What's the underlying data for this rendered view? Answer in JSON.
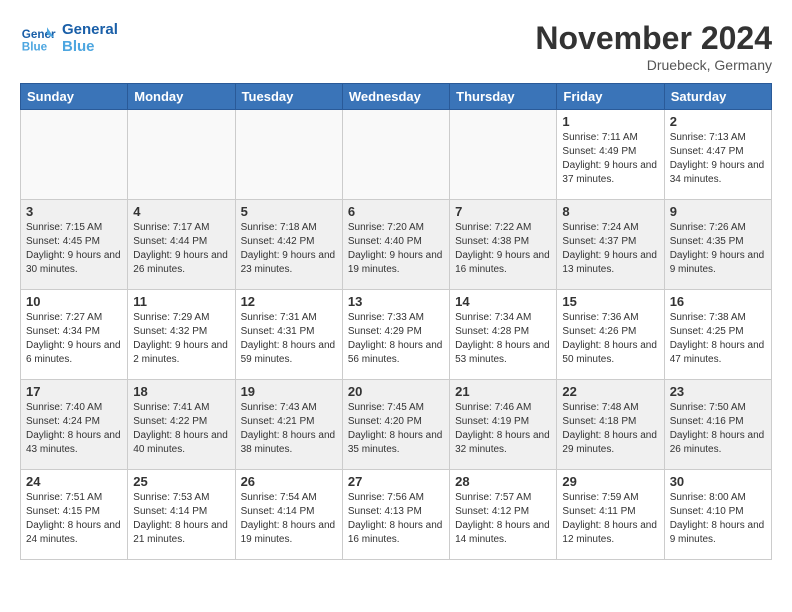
{
  "header": {
    "logo_line1": "General",
    "logo_line2": "Blue",
    "month_title": "November 2024",
    "location": "Druebeck, Germany"
  },
  "weekdays": [
    "Sunday",
    "Monday",
    "Tuesday",
    "Wednesday",
    "Thursday",
    "Friday",
    "Saturday"
  ],
  "weeks": [
    [
      {
        "day": "",
        "info": ""
      },
      {
        "day": "",
        "info": ""
      },
      {
        "day": "",
        "info": ""
      },
      {
        "day": "",
        "info": ""
      },
      {
        "day": "",
        "info": ""
      },
      {
        "day": "1",
        "info": "Sunrise: 7:11 AM\nSunset: 4:49 PM\nDaylight: 9 hours and 37 minutes."
      },
      {
        "day": "2",
        "info": "Sunrise: 7:13 AM\nSunset: 4:47 PM\nDaylight: 9 hours and 34 minutes."
      }
    ],
    [
      {
        "day": "3",
        "info": "Sunrise: 7:15 AM\nSunset: 4:45 PM\nDaylight: 9 hours and 30 minutes."
      },
      {
        "day": "4",
        "info": "Sunrise: 7:17 AM\nSunset: 4:44 PM\nDaylight: 9 hours and 26 minutes."
      },
      {
        "day": "5",
        "info": "Sunrise: 7:18 AM\nSunset: 4:42 PM\nDaylight: 9 hours and 23 minutes."
      },
      {
        "day": "6",
        "info": "Sunrise: 7:20 AM\nSunset: 4:40 PM\nDaylight: 9 hours and 19 minutes."
      },
      {
        "day": "7",
        "info": "Sunrise: 7:22 AM\nSunset: 4:38 PM\nDaylight: 9 hours and 16 minutes."
      },
      {
        "day": "8",
        "info": "Sunrise: 7:24 AM\nSunset: 4:37 PM\nDaylight: 9 hours and 13 minutes."
      },
      {
        "day": "9",
        "info": "Sunrise: 7:26 AM\nSunset: 4:35 PM\nDaylight: 9 hours and 9 minutes."
      }
    ],
    [
      {
        "day": "10",
        "info": "Sunrise: 7:27 AM\nSunset: 4:34 PM\nDaylight: 9 hours and 6 minutes."
      },
      {
        "day": "11",
        "info": "Sunrise: 7:29 AM\nSunset: 4:32 PM\nDaylight: 9 hours and 2 minutes."
      },
      {
        "day": "12",
        "info": "Sunrise: 7:31 AM\nSunset: 4:31 PM\nDaylight: 8 hours and 59 minutes."
      },
      {
        "day": "13",
        "info": "Sunrise: 7:33 AM\nSunset: 4:29 PM\nDaylight: 8 hours and 56 minutes."
      },
      {
        "day": "14",
        "info": "Sunrise: 7:34 AM\nSunset: 4:28 PM\nDaylight: 8 hours and 53 minutes."
      },
      {
        "day": "15",
        "info": "Sunrise: 7:36 AM\nSunset: 4:26 PM\nDaylight: 8 hours and 50 minutes."
      },
      {
        "day": "16",
        "info": "Sunrise: 7:38 AM\nSunset: 4:25 PM\nDaylight: 8 hours and 47 minutes."
      }
    ],
    [
      {
        "day": "17",
        "info": "Sunrise: 7:40 AM\nSunset: 4:24 PM\nDaylight: 8 hours and 43 minutes."
      },
      {
        "day": "18",
        "info": "Sunrise: 7:41 AM\nSunset: 4:22 PM\nDaylight: 8 hours and 40 minutes."
      },
      {
        "day": "19",
        "info": "Sunrise: 7:43 AM\nSunset: 4:21 PM\nDaylight: 8 hours and 38 minutes."
      },
      {
        "day": "20",
        "info": "Sunrise: 7:45 AM\nSunset: 4:20 PM\nDaylight: 8 hours and 35 minutes."
      },
      {
        "day": "21",
        "info": "Sunrise: 7:46 AM\nSunset: 4:19 PM\nDaylight: 8 hours and 32 minutes."
      },
      {
        "day": "22",
        "info": "Sunrise: 7:48 AM\nSunset: 4:18 PM\nDaylight: 8 hours and 29 minutes."
      },
      {
        "day": "23",
        "info": "Sunrise: 7:50 AM\nSunset: 4:16 PM\nDaylight: 8 hours and 26 minutes."
      }
    ],
    [
      {
        "day": "24",
        "info": "Sunrise: 7:51 AM\nSunset: 4:15 PM\nDaylight: 8 hours and 24 minutes."
      },
      {
        "day": "25",
        "info": "Sunrise: 7:53 AM\nSunset: 4:14 PM\nDaylight: 8 hours and 21 minutes."
      },
      {
        "day": "26",
        "info": "Sunrise: 7:54 AM\nSunset: 4:14 PM\nDaylight: 8 hours and 19 minutes."
      },
      {
        "day": "27",
        "info": "Sunrise: 7:56 AM\nSunset: 4:13 PM\nDaylight: 8 hours and 16 minutes."
      },
      {
        "day": "28",
        "info": "Sunrise: 7:57 AM\nSunset: 4:12 PM\nDaylight: 8 hours and 14 minutes."
      },
      {
        "day": "29",
        "info": "Sunrise: 7:59 AM\nSunset: 4:11 PM\nDaylight: 8 hours and 12 minutes."
      },
      {
        "day": "30",
        "info": "Sunrise: 8:00 AM\nSunset: 4:10 PM\nDaylight: 8 hours and 9 minutes."
      }
    ]
  ]
}
